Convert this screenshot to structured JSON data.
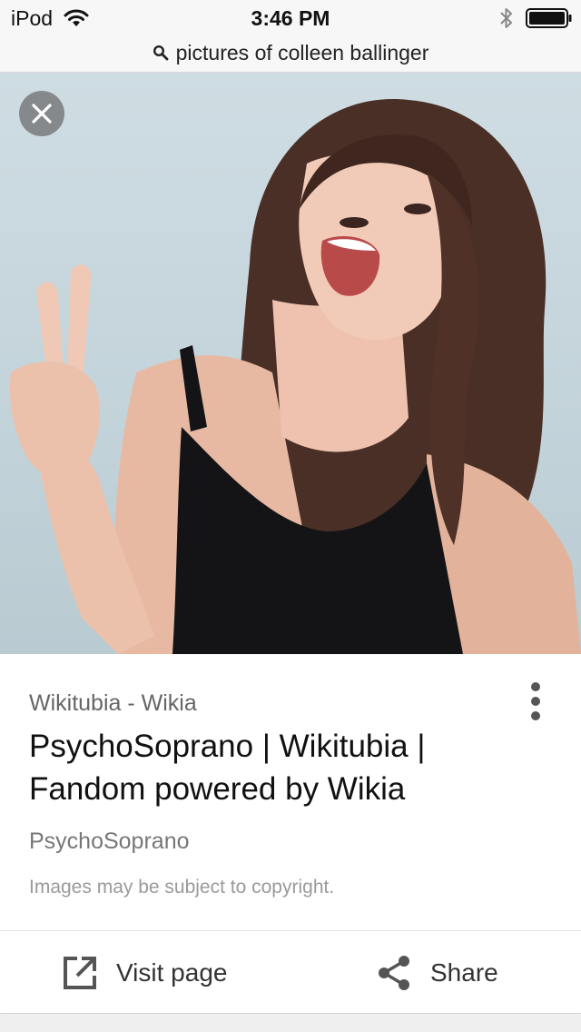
{
  "status_bar": {
    "carrier": "iPod",
    "time": "3:46 PM",
    "icons": [
      "wifi-icon",
      "bluetooth-icon",
      "battery-icon"
    ]
  },
  "url_bar": {
    "icon": "search-icon",
    "text": "pictures of colleen ballinger"
  },
  "viewer": {
    "close_icon": "close-icon",
    "image_subject": "woman-peace-sign-photo"
  },
  "result": {
    "site": "Wikitubia - Wikia",
    "title": "PsychoSoprano | Wikitubia | Fandom powered by Wikia",
    "subtitle": "PsychoSoprano",
    "notice": "Images may be subject to copyright.",
    "more_icon": "more-vertical-icon"
  },
  "actions": {
    "visit_label": "Visit page",
    "visit_icon": "open-in-new-icon",
    "share_label": "Share",
    "share_icon": "share-icon"
  },
  "colors": {
    "photo_background": "#c7d6dc",
    "text_primary": "#111111",
    "text_secondary": "#777777"
  }
}
